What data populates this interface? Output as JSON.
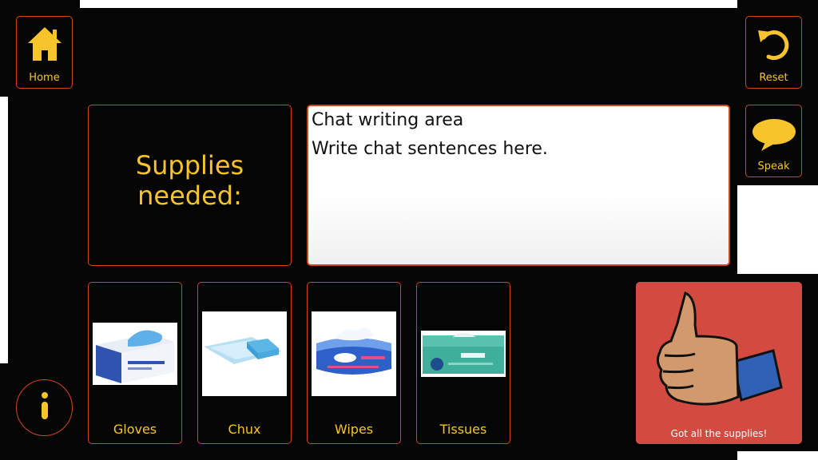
{
  "nav": {
    "home_label": "Home",
    "reset_label": "Reset",
    "speak_label": "Speak"
  },
  "title_panel": {
    "line1": "Supplies",
    "line2": "needed:"
  },
  "chat": {
    "heading": "Chat writing area",
    "placeholder": "Write chat sentences here."
  },
  "supplies": [
    {
      "label": "Gloves",
      "icon": "gloves-box-icon"
    },
    {
      "label": "Chux",
      "icon": "chux-pad-icon"
    },
    {
      "label": "Wipes",
      "icon": "wipes-pack-icon"
    },
    {
      "label": "Tissues",
      "icon": "tissues-box-icon"
    }
  ],
  "done_button": {
    "label": "Got all the supplies!",
    "icon": "thumbs-up-icon"
  },
  "colors": {
    "accent": "#f7c52b",
    "border": "#d2451e",
    "panel": "#050505",
    "done_bg": "#d24a40"
  }
}
